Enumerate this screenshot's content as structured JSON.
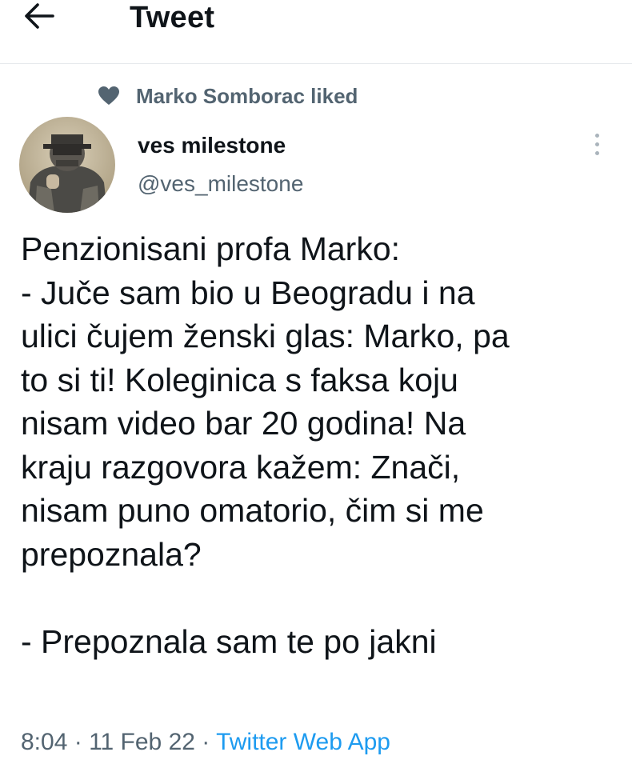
{
  "header": {
    "title": "Tweet",
    "back_icon": "arrow-left-icon"
  },
  "social_context": {
    "icon": "heart-icon",
    "text": "Marko Somborac liked"
  },
  "author": {
    "display_name": "ves milestone",
    "handle": "@ves_milestone"
  },
  "tweet": {
    "lines": [
      "Penzionisani profa Marko:",
      "- Juče sam bio u Beogradu i na",
      "ulici čujem ženski glas: Marko, pa",
      "to si ti! Koleginica s faksa koju",
      "nisam video bar 20 godina! Na",
      "kraju razgovora kažem: Znači,",
      "nisam puno omatorio, čim si me",
      "prepoznala?",
      "",
      "- Prepoznala sam te po jakni"
    ]
  },
  "meta": {
    "time": "8:04",
    "separator": " · ",
    "date": "11 Feb 22",
    "source": "Twitter Web App"
  },
  "colors": {
    "text_primary": "#0f1419",
    "text_secondary": "#536471",
    "link": "#1d9bf0",
    "divider": "#e6e9ec"
  }
}
